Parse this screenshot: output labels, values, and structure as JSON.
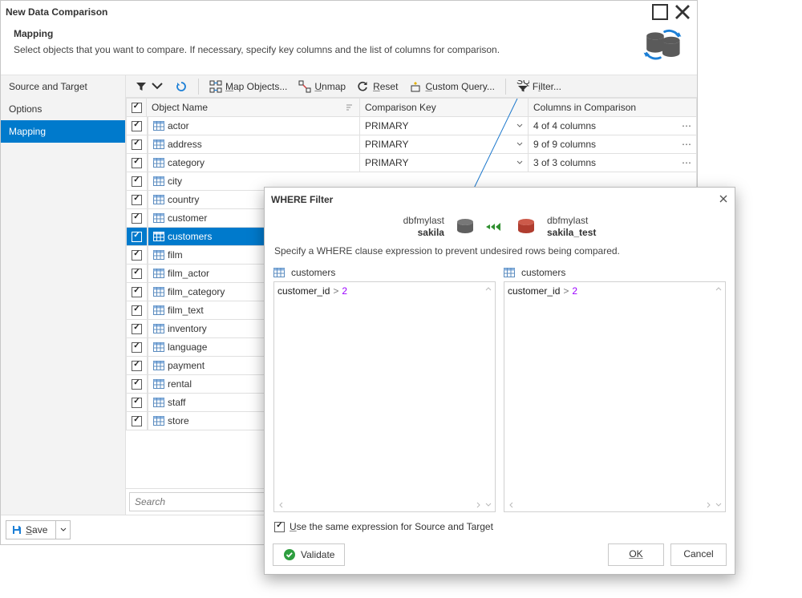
{
  "window": {
    "title": "New Data Comparison",
    "subtitle": "Mapping",
    "description": "Select objects that you want to compare. If necessary, specify key columns and the list of columns for comparison."
  },
  "sidebar": {
    "items": [
      {
        "label": "Source and Target",
        "active": false
      },
      {
        "label": "Options",
        "active": false
      },
      {
        "label": "Mapping",
        "active": true
      }
    ]
  },
  "toolbar": {
    "map_objects": "Map Objects...",
    "unmap": "Unmap",
    "reset": "Reset",
    "custom_query": "Custom Query...",
    "filter": "Filter..."
  },
  "grid": {
    "headers": {
      "object": "Object Name",
      "key": "Comparison Key",
      "cols": "Columns in Comparison"
    },
    "rows": [
      {
        "checked": true,
        "name": "actor",
        "key": "PRIMARY",
        "cols": "4 of 4 columns"
      },
      {
        "checked": true,
        "name": "address",
        "key": "PRIMARY",
        "cols": "9 of 9 columns"
      },
      {
        "checked": true,
        "name": "category",
        "key": "PRIMARY",
        "cols": "3 of 3 columns"
      },
      {
        "checked": true,
        "name": "city"
      },
      {
        "checked": true,
        "name": "country"
      },
      {
        "checked": true,
        "name": "customer"
      },
      {
        "checked": true,
        "name": "customers",
        "selected": true
      },
      {
        "checked": true,
        "name": "film"
      },
      {
        "checked": true,
        "name": "film_actor"
      },
      {
        "checked": true,
        "name": "film_category"
      },
      {
        "checked": true,
        "name": "film_text"
      },
      {
        "checked": true,
        "name": "inventory"
      },
      {
        "checked": true,
        "name": "language"
      },
      {
        "checked": true,
        "name": "payment"
      },
      {
        "checked": true,
        "name": "rental"
      },
      {
        "checked": true,
        "name": "staff"
      },
      {
        "checked": true,
        "name": "store"
      }
    ]
  },
  "search": {
    "placeholder": "Search"
  },
  "footer": {
    "save": "Save"
  },
  "modal": {
    "title": "WHERE Filter",
    "source_server": "dbfmylast",
    "source_db": "sakila",
    "target_server": "dbfmylast",
    "target_db": "sakila_test",
    "instruction": "Specify a WHERE clause expression to prevent undesired rows being compared.",
    "left_table": "customers",
    "right_table": "customers",
    "left_expr": {
      "id": "customer_id",
      "op": ">",
      "val": "2"
    },
    "right_expr": {
      "id": "customer_id",
      "op": ">",
      "val": "2"
    },
    "same_expr_label": "Use the same expression for Source and Target",
    "same_expr_checked": true,
    "validate": "Validate",
    "ok": "OK",
    "cancel": "Cancel"
  }
}
